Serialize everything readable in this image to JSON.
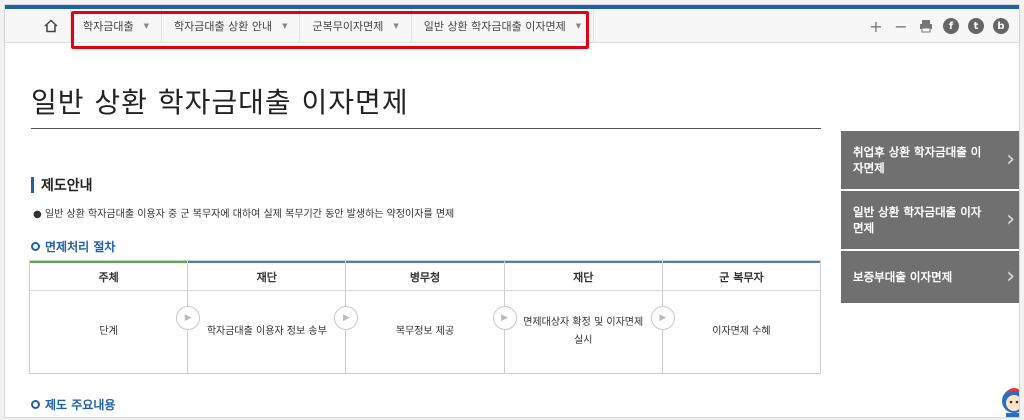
{
  "nav": {
    "home_icon": "home-icon",
    "breadcrumbs": [
      {
        "label": "학자금대출"
      },
      {
        "label": "학자금대출 상환 안내"
      },
      {
        "label": "군복무이자면제"
      },
      {
        "label": "일반 상환 학자금대출 이자면제"
      }
    ],
    "tools": {
      "zoom_in": "+",
      "zoom_out": "−",
      "print_icon": "print-icon",
      "facebook": "f",
      "twitter": "t",
      "blog": "b"
    }
  },
  "page": {
    "title": "일반 상환 학자금대출 이자면제"
  },
  "sidebar": {
    "items": [
      {
        "label": "취업후 상환 학자금대출 이자면제"
      },
      {
        "label": "일반 상환 학자금대출 이자면제"
      },
      {
        "label": "보증부대출 이자면제"
      }
    ]
  },
  "content": {
    "section_title": "제도안내",
    "bullet": "● 일반 상환 학자금대출 이용자 중 군 복무자에 대하여 실제 복무기간 동안 발생하는 약정이자를 면제",
    "process_title": "면제처리 절차",
    "steps": [
      {
        "head": "주체",
        "body": "단계"
      },
      {
        "head": "재단",
        "body": "학자금대출 이용자 정보 송부"
      },
      {
        "head": "병무청",
        "body": "복무정보 제공"
      },
      {
        "head": "재단",
        "body": "면제대상자 확정 및 이자면제 실시"
      },
      {
        "head": "군 복무자",
        "body": "이자면제 수혜"
      }
    ],
    "next_title": "제도 주요내용"
  },
  "colors": {
    "accent": "#1f5fad",
    "sidebar_bg": "#707070",
    "highlight": "#e60012"
  }
}
